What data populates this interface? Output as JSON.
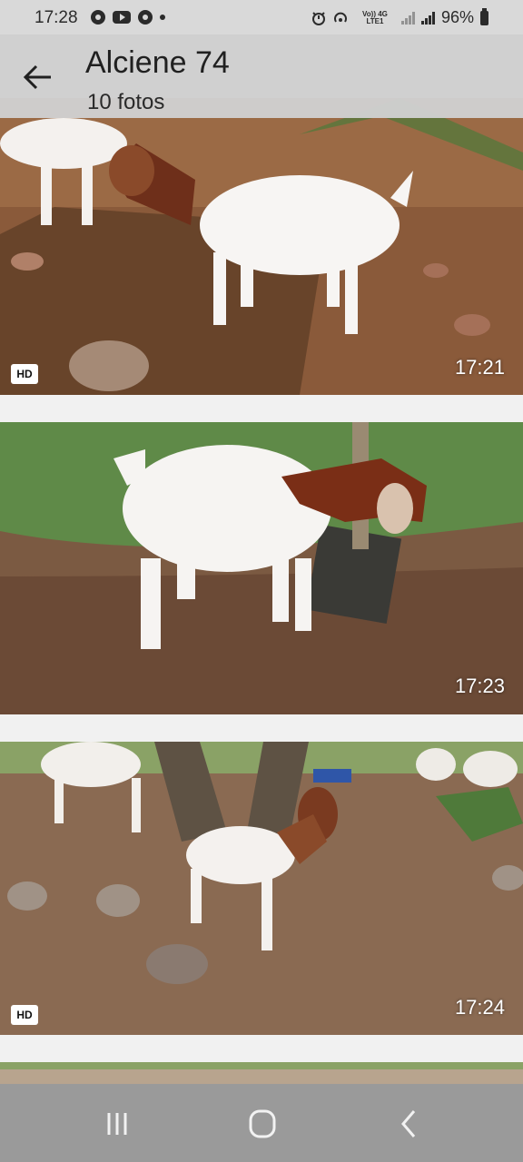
{
  "status_bar": {
    "time": "17:28",
    "network_label": "Vo)) 4G LTE1",
    "battery": "96%"
  },
  "header": {
    "title": "Alciene 74",
    "subtitle": "10 fotos"
  },
  "photos": [
    {
      "time": "17:21",
      "hd": "HD"
    },
    {
      "time": "17:23",
      "hd": ""
    },
    {
      "time": "17:24",
      "hd": "HD"
    }
  ]
}
